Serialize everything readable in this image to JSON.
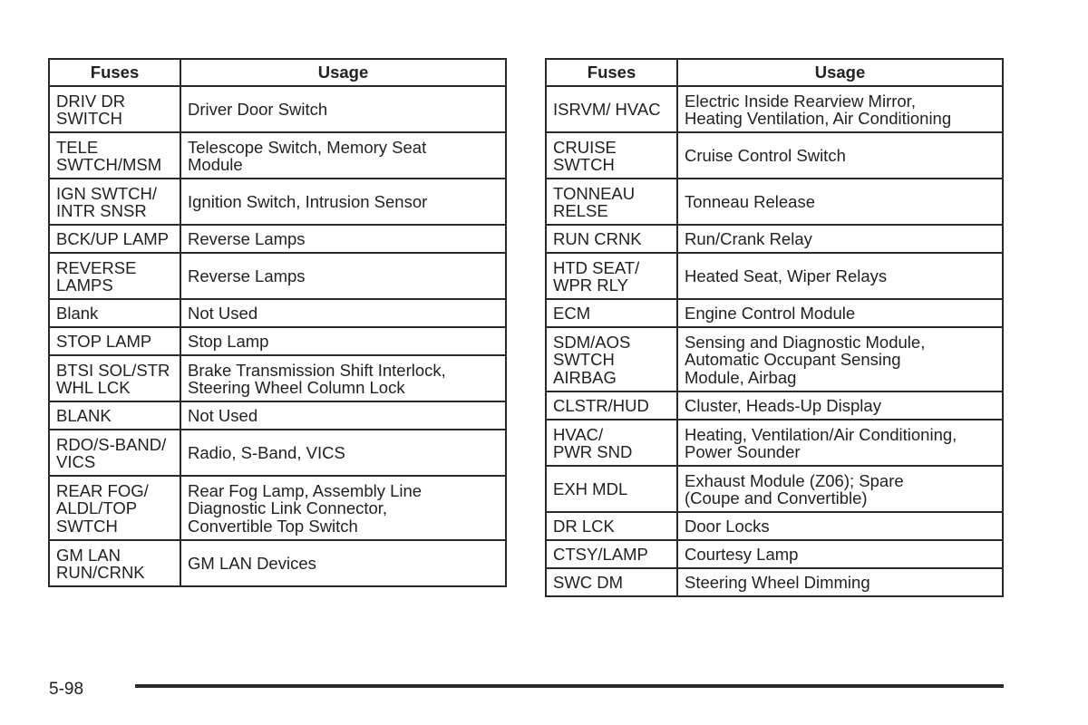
{
  "tables": [
    {
      "headers": {
        "fuse": "Fuses",
        "usage": "Usage"
      },
      "rows": [
        {
          "fuse": "DRIV DR\nSWITCH",
          "usage": "Driver Door Switch",
          "lines": 2
        },
        {
          "fuse": "TELE\nSWTCH/MSM",
          "usage": "Telescope Switch, Memory Seat\nModule",
          "lines": 2
        },
        {
          "fuse": "IGN SWTCH/\nINTR SNSR",
          "usage": "Ignition Switch, Intrusion Sensor",
          "lines": 2
        },
        {
          "fuse": "BCK/UP LAMP",
          "usage": "Reverse Lamps",
          "lines": 1
        },
        {
          "fuse": "REVERSE\nLAMPS",
          "usage": "Reverse Lamps",
          "lines": 2
        },
        {
          "fuse": "Blank",
          "usage": "Not Used",
          "lines": 1
        },
        {
          "fuse": "STOP LAMP",
          "usage": "Stop Lamp",
          "lines": 1
        },
        {
          "fuse": "BTSI SOL/STR\nWHL LCK",
          "usage": "Brake Transmission Shift Interlock,\nSteering Wheel Column Lock",
          "lines": 2
        },
        {
          "fuse": "BLANK",
          "usage": "Not Used",
          "lines": 1
        },
        {
          "fuse": "RDO/S-BAND/\nVICS",
          "usage": "Radio, S-Band, VICS",
          "lines": 2
        },
        {
          "fuse": "REAR FOG/\nALDL/TOP\nSWTCH",
          "usage": "Rear Fog Lamp, Assembly Line\nDiagnostic Link Connector,\nConvertible Top Switch",
          "lines": 3
        },
        {
          "fuse": "GM LAN\nRUN/CRNK",
          "usage": "GM LAN Devices",
          "lines": 2
        }
      ]
    },
    {
      "headers": {
        "fuse": "Fuses",
        "usage": "Usage"
      },
      "rows": [
        {
          "fuse": "ISRVM/ HVAC",
          "usage": "Electric Inside Rearview Mirror,\nHeating Ventilation, Air Conditioning",
          "lines": 2
        },
        {
          "fuse": "CRUISE\nSWTCH",
          "usage": "Cruise Control Switch",
          "lines": 2
        },
        {
          "fuse": "TONNEAU\nRELSE",
          "usage": "Tonneau Release",
          "lines": 2
        },
        {
          "fuse": "RUN CRNK",
          "usage": "Run/Crank Relay",
          "lines": 1
        },
        {
          "fuse": "HTD SEAT/\nWPR RLY",
          "usage": "Heated Seat, Wiper Relays",
          "lines": 2
        },
        {
          "fuse": "ECM",
          "usage": "Engine Control Module",
          "lines": 1
        },
        {
          "fuse": "SDM/AOS\nSWTCH\nAIRBAG",
          "usage": "Sensing and Diagnostic Module,\nAutomatic Occupant Sensing\nModule, Airbag",
          "lines": 3
        },
        {
          "fuse": "CLSTR/HUD",
          "usage": "Cluster, Heads-Up Display",
          "lines": 1
        },
        {
          "fuse": "HVAC/\nPWR SND",
          "usage": "Heating, Ventilation/Air Conditioning,\nPower Sounder",
          "lines": 2
        },
        {
          "fuse": "EXH MDL",
          "usage": "Exhaust Module (Z06); Spare\n(Coupe and Convertible)",
          "lines": 2
        },
        {
          "fuse": "DR LCK",
          "usage": "Door Locks",
          "lines": 1
        },
        {
          "fuse": "CTSY/LAMP",
          "usage": "Courtesy Lamp",
          "lines": 1
        },
        {
          "fuse": "SWC DM",
          "usage": "Steering Wheel Dimming",
          "lines": 1
        }
      ]
    }
  ],
  "footer": {
    "page_number": "5-98"
  }
}
